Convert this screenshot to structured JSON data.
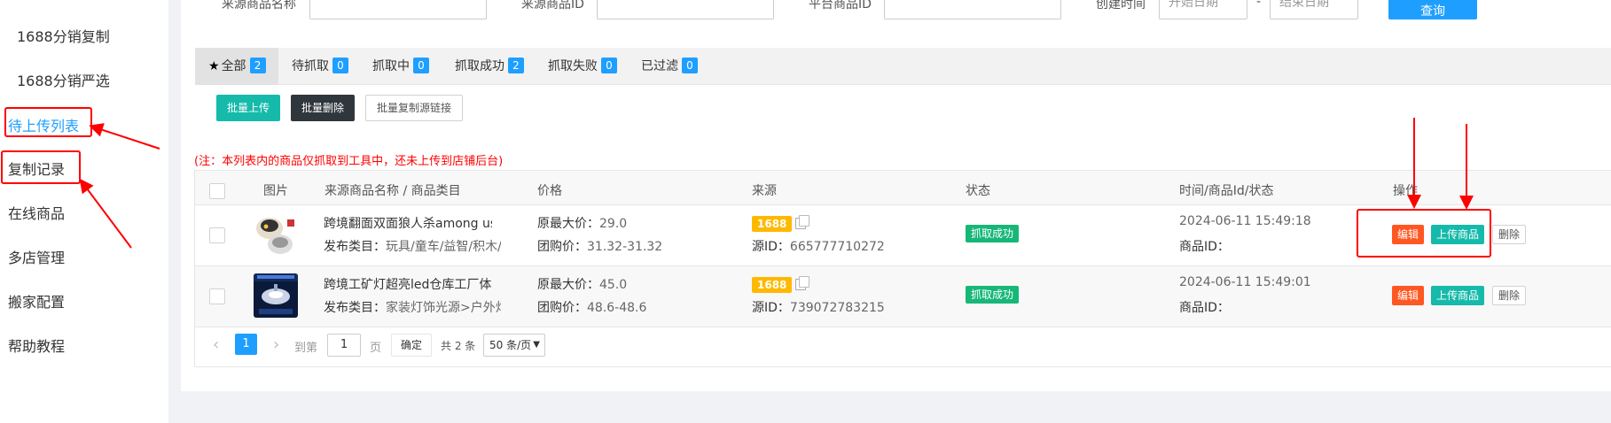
{
  "sidebar": {
    "items": [
      {
        "label": "1688分销复制"
      },
      {
        "label": "1688分销严选"
      },
      {
        "label": "待上传列表"
      },
      {
        "label": "复制记录"
      },
      {
        "label": "在线商品"
      },
      {
        "label": "多店管理"
      },
      {
        "label": "搬家配置"
      },
      {
        "label": "帮助教程"
      }
    ],
    "active_color": "#1e9fff"
  },
  "filters": {
    "source_name_label": "来源商品名称",
    "source_id_label": "来源商品ID",
    "platform_id_label": "平台商品ID",
    "created_label": "创建时间",
    "start_placeholder": "开始日期",
    "date_separator": "-",
    "end_placeholder": "结束日期",
    "search_label": "查询"
  },
  "tabs": [
    {
      "label": "全部",
      "count": "2"
    },
    {
      "label": "待抓取",
      "count": "0"
    },
    {
      "label": "抓取中",
      "count": "0"
    },
    {
      "label": "抓取成功",
      "count": "2"
    },
    {
      "label": "抓取失败",
      "count": "0"
    },
    {
      "label": "已过滤",
      "count": "0"
    }
  ],
  "actions": {
    "batch_upload": "批量上传",
    "batch_delete": "批量删除",
    "batch_copy_links": "批量复制源链接"
  },
  "note": "(注：本列表内的商品仅抓取到工具中，还未上传到店铺后台)",
  "table": {
    "headers": {
      "image": "图片",
      "name": "来源商品名称 / 商品类目",
      "price": "价格",
      "source": "来源",
      "status": "状态",
      "time": "时间/商品Id/状态",
      "ops": "操作"
    },
    "rows": [
      {
        "name": "跨境翻面双面狼人杀among us plu",
        "category_label": "发布类目：",
        "category": "玩具/童车/益智/积木/模型",
        "max_price_label": "原最大价：",
        "max_price": "29.0",
        "group_price_label": "团购价：",
        "group_price": "31.32-31.32",
        "source_tag": "1688",
        "source_id_label": "源ID：",
        "source_id": "665777710272",
        "status": "抓取成功",
        "time": "2024-06-11 15:49:18",
        "product_id_label": "商品ID：",
        "edit": "编辑",
        "upload": "上传商品",
        "delete": "删除"
      },
      {
        "name": "跨境工矿灯超亮led仓库工厂体育馆",
        "category_label": "发布类目：",
        "category": "家装灯饰光源>户外灯具/庭院灯",
        "max_price_label": "原最大价：",
        "max_price": "45.0",
        "group_price_label": "团购价：",
        "group_price": "48.6-48.6",
        "source_tag": "1688",
        "source_id_label": "源ID：",
        "source_id": "739072783215",
        "status": "抓取成功",
        "time": "2024-06-11 15:49:01",
        "product_id_label": "商品ID：",
        "edit": "编辑",
        "upload": "上传商品",
        "delete": "删除"
      }
    ]
  },
  "pagination": {
    "prev": "‹",
    "current": "1",
    "next": "›",
    "goto_label": "到第",
    "page_value": "1",
    "page_unit": "页",
    "confirm": "确定",
    "total": "共 2 条",
    "page_size": "50 条/页"
  },
  "icons": [
    "star-icon",
    "copy-icon",
    "product-thumbnail",
    "arrow-annotation"
  ],
  "colors": {
    "primary": "#1e9fff",
    "danger": "#ff5722",
    "teal": "#16baaa",
    "success": "#16b777",
    "tag": "#ffb800",
    "annotation": "#ff0000"
  }
}
